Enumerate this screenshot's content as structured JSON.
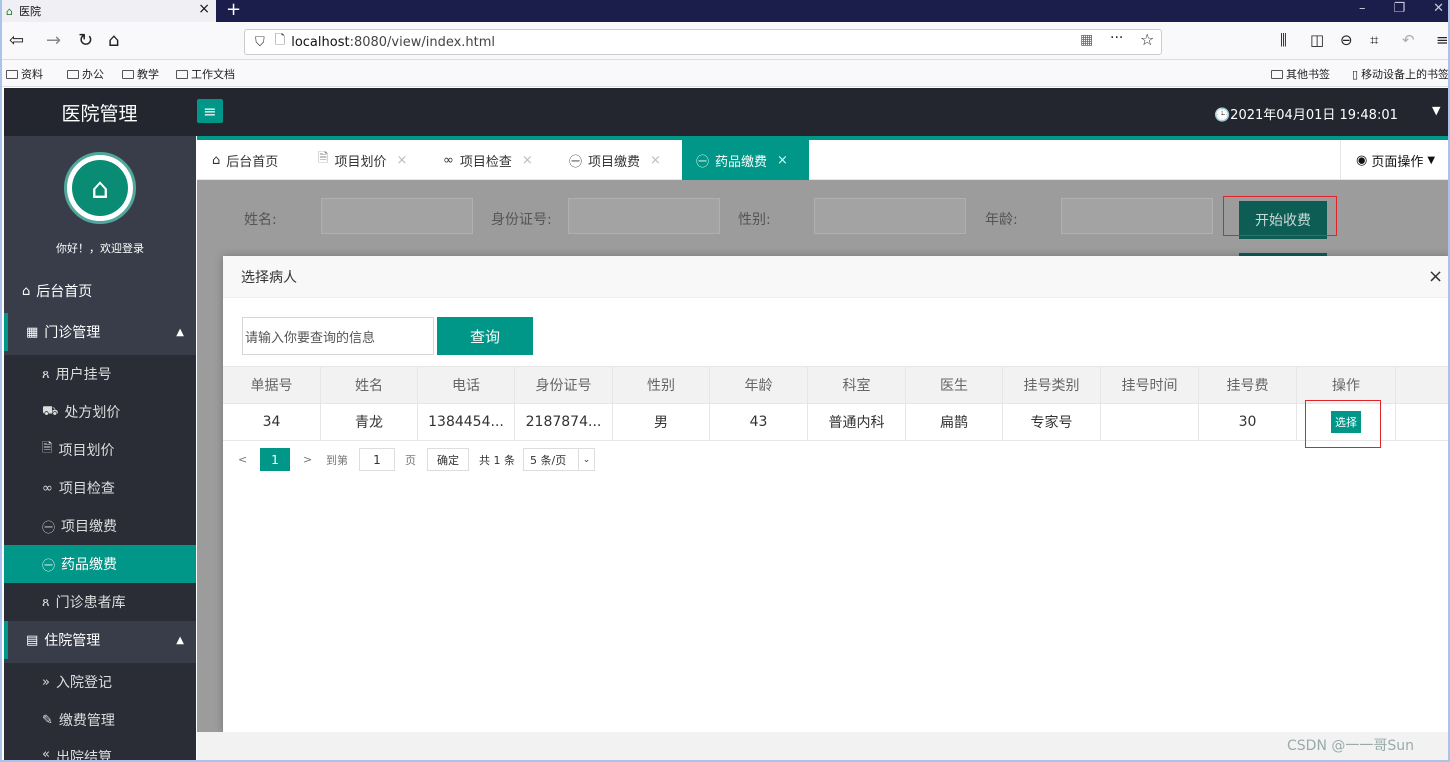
{
  "browser": {
    "tab_title": "医院",
    "tab_favicon": "hospital-icon",
    "new_tab": "+",
    "url_host": "localhost",
    "url_rest": ":8080/view/index.html",
    "bookmarks": [
      "资料",
      "办公",
      "教学",
      "工作文档"
    ],
    "bookmarks_right": [
      "其他书签",
      "移动设备上的书签"
    ]
  },
  "app": {
    "brand": "医院管理",
    "menu_toggle": "≡",
    "clock": "🕒2021年04月01日 19:48:01",
    "accent": "#009688"
  },
  "sidebar": {
    "welcome": "你好！，欢迎登录",
    "home": "后台首页",
    "group1": "门诊管理",
    "group1_items": [
      "用户挂号",
      "处方划价",
      "项目划价",
      "项目检查",
      "项目缴费",
      "药品缴费",
      "门诊患者库"
    ],
    "group2": "住院管理",
    "group2_items": [
      "入院登记",
      "缴费管理",
      "出院结算"
    ]
  },
  "tabs": {
    "items": [
      "后台首页",
      "项目划价",
      "项目检查",
      "项目缴费",
      "药品缴费"
    ],
    "active": "药品缴费",
    "page_ops": "页面操作"
  },
  "form": {
    "name_label": "姓名:",
    "id_label": "身份证号:",
    "gender_label": "性别:",
    "age_label": "年龄:",
    "start_button": "开始收费"
  },
  "modal": {
    "title": "选择病人",
    "close": "×",
    "search_placeholder": "请输入你要查询的信息",
    "query_button": "查询",
    "columns": [
      "单据号",
      "姓名",
      "电话",
      "身份证号",
      "性别",
      "年龄",
      "科室",
      "医生",
      "挂号类别",
      "挂号时间",
      "挂号费",
      "操作"
    ],
    "rows": [
      [
        "34",
        "青龙",
        "1384454...",
        "2187874...",
        "男",
        "43",
        "普通内科",
        "扁鹊",
        "专家号",
        "",
        "30",
        "选择"
      ]
    ]
  },
  "pager": {
    "prev": "<",
    "current": "1",
    "next": ">",
    "goto": "到第",
    "page_value": "1",
    "page_unit": "页",
    "confirm": "确定",
    "total": "共 1 条",
    "page_size": "5 条/页"
  },
  "watermark": "CSDN @一一哥Sun"
}
